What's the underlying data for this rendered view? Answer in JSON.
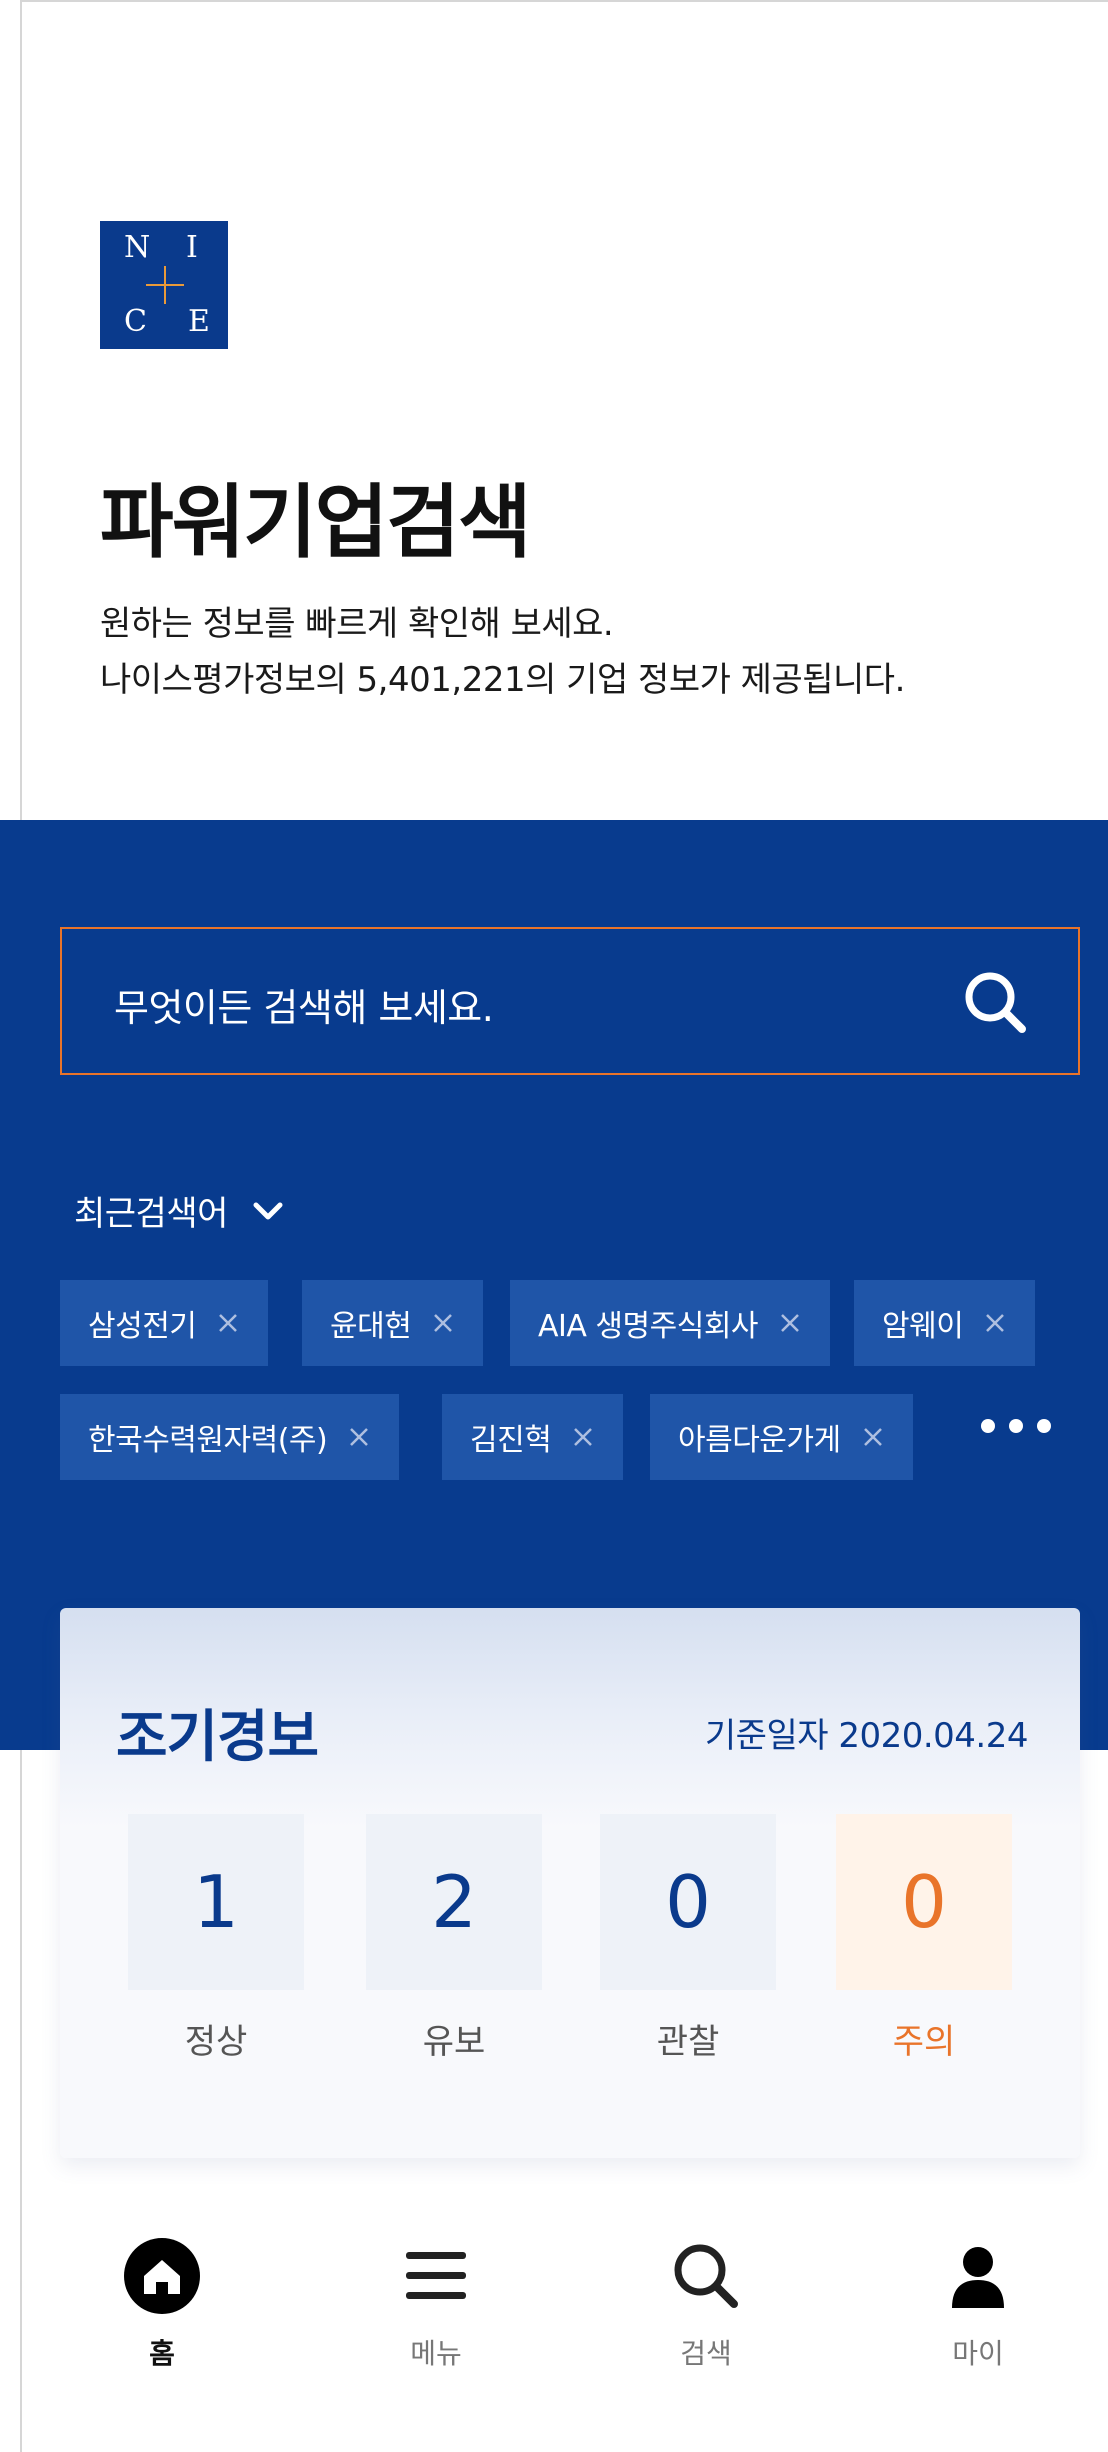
{
  "logo": {
    "letters": [
      "N",
      "I",
      "C",
      "E"
    ]
  },
  "header": {
    "title": "파워기업검색",
    "desc_line1": "원하는 정보를 빠르게 확인해 보세요.",
    "desc_line2": "나이스평가정보의 5,401,221의 기업 정보가 제공됩니다."
  },
  "search": {
    "placeholder": "무엇이든 검색해 보세요.",
    "icon": "search-icon"
  },
  "recent": {
    "label": "최근검색어",
    "chips": [
      "삼성전기",
      "윤대현",
      "AIA 생명주식회사",
      "암웨이",
      "한국수력원자력(주)",
      "김진혁",
      "아름다운가게"
    ]
  },
  "warning": {
    "title": "조기경보",
    "date": "기준일자 2020.04.24",
    "stats": [
      {
        "value": "1",
        "label": "정상"
      },
      {
        "value": "2",
        "label": "유보"
      },
      {
        "value": "0",
        "label": "관찰"
      },
      {
        "value": "0",
        "label": "주의"
      }
    ]
  },
  "nav": {
    "items": [
      {
        "label": "홈",
        "icon": "home-icon"
      },
      {
        "label": "메뉴",
        "icon": "menu-icon"
      },
      {
        "label": "검색",
        "icon": "search-icon"
      },
      {
        "label": "마이",
        "icon": "person-icon"
      }
    ]
  },
  "colors": {
    "brand_blue": "#083b8e",
    "chip_blue": "#1f55a8",
    "accent_orange": "#e9742a",
    "logo_cross": "#e99a3a"
  }
}
